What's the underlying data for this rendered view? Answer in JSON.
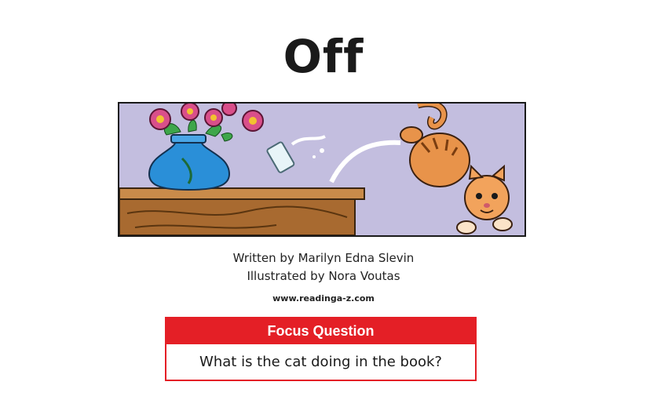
{
  "book": {
    "title": "Off",
    "author_line": "Written by Marilyn Edna Slevin",
    "illustrator_line": "Illustrated by Nora Voutas",
    "website": "www.readinga-z.com"
  },
  "focus_question": {
    "heading": "Focus Question",
    "question": "What is the cat doing in the book?"
  },
  "colors": {
    "accent_red": "#e41f26",
    "wall": "#c3bedf",
    "table_wood": "#b87a3d",
    "vase_blue": "#2a8fd8",
    "cat_orange": "#e8934a"
  }
}
